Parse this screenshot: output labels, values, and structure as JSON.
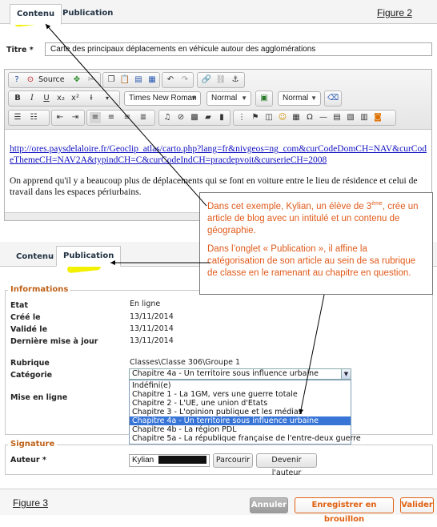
{
  "top": {
    "tabs": [
      {
        "label": "Contenu"
      },
      {
        "label": "Publication"
      }
    ],
    "figure_label": "Figure 2",
    "title_label": "Titre *",
    "title_value": "Carte des principaux déplacements en véhicule autour des agglomérations"
  },
  "toolbar": {
    "source_label": "Source",
    "font_name": "Times New Roman",
    "font_size": "Normal",
    "format": "Normal"
  },
  "editor_content": {
    "link_text": "http://ores.paysdelaloire.fr/Geoclip_atlas/carto.php?lang=fr&nivgeos=ng_com&curCodeDomCH=NAV&curCodeThemeCH=NAV2A&typindCH=C&curCodeIndCH=pracdepvoit&curserieCH=2008",
    "paragraph": "On apprend qu'il y a beaucoup plus de déplacements qui se font en voiture entre le lieu de résidence et celui de travail dans les espaces périurbains."
  },
  "callout": {
    "p1_a": "Dans cet exemple, Kylian, un élève de 3",
    "p1_sup": "ème",
    "p1_b": ", crée un article de blog avec un intitulé et un contenu de géographie.",
    "p2": "Dans l’onglet « Publication », il affine la catégorisation de son article au sein de sa rubrique de classe en le ramenant au chapitre en question."
  },
  "bottom": {
    "tabs": [
      {
        "label": "Contenu"
      },
      {
        "label": "Publication"
      }
    ],
    "informations_legend": "Informations",
    "etat_label": "Etat",
    "etat_value": "En ligne",
    "cree_label": "Créé le",
    "cree_value": "13/11/2014",
    "valide_label": "Validé le",
    "valide_value": "13/11/2014",
    "maj_label": "Dernière mise à jour",
    "maj_value": "13/11/2014",
    "rubrique_label": "Rubrique",
    "rubrique_value": "Classes\\Classe 306\\Groupe 1",
    "categorie_label": "Catégorie",
    "categorie_value": "Chapitre 4a - Un territoire sous influence urbaine",
    "mise_en_ligne_label": "Mise en ligne",
    "options": [
      "Indéfini(e)",
      "Chapitre 1 - La 1GM, vers une guerre totale",
      "Chapitre 2 - L'UE, une union d'Etats",
      "Chapitre 3 - L'opinion publique et les médias",
      "Chapitre 4a - Un territoire sous influence urbaine",
      "Chapitre 4b - La région PDL",
      "Chapitre 5a - La république française de l'entre-deux guerre"
    ],
    "selected_index": 4,
    "signature_legend": "Signature",
    "auteur_label": "Auteur *",
    "auteur_value": "Kylian",
    "parcourir_label": "Parcourir",
    "devenir_label": "Devenir l'auteur",
    "figure_label": "Figure 3",
    "annuler_label": "Annuler",
    "brouillon_label": "Enregistrer en brouillon",
    "valider_label": "Valider"
  },
  "colors": {
    "highlight": "#f3f000",
    "callout_text": "#e05a1a",
    "legend": "#c0631a",
    "selected_option": "#3875d7",
    "link": "#1010c0"
  }
}
